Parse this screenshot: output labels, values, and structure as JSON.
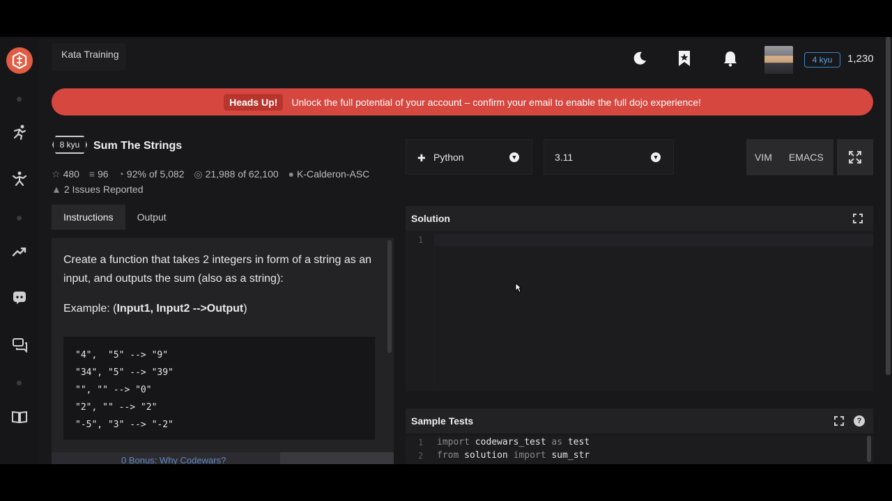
{
  "topbar": {
    "title": "Kata Training",
    "rank": "4 kyu",
    "honor": "1,230"
  },
  "banner": {
    "label": "Heads Up!",
    "message": "Unlock the full potential of your account – confirm your email to enable the full dojo experience!"
  },
  "kata": {
    "rank": "8 kyu",
    "title": "Sum The Strings",
    "stars": "480",
    "collections": "96",
    "satisfaction_pct": "92%",
    "satisfaction_of": "of 5,082",
    "completed": "21,988",
    "completed_of": "of 62,100",
    "author": "K-Calderon-ASC",
    "issues": "2 Issues Reported"
  },
  "tabs": [
    "Instructions",
    "Output"
  ],
  "instructions": {
    "text": "Create a function that takes 2 integers in form of a string as an input, and outputs the sum (also as a string):",
    "example_prefix": "Example: (",
    "example_bold": "Input1, Input2 -->Output",
    "example_suffix": ")",
    "code": "\"4\",  \"5\" --> \"9\"\n\"34\", \"5\" --> \"39\"\n\"\", \"\" --> \"0\"\n\"2\", \"\" --> \"2\"\n\"-5\", \"3\" --> \"-2\"",
    "bottom_link": "0 Bonus: Why Codewars?"
  },
  "editor_settings": {
    "language": "Python",
    "version": "3.11",
    "modes": [
      "VIM",
      "EMACS"
    ]
  },
  "solution": {
    "title": "Solution",
    "line_numbers": [
      "1"
    ]
  },
  "sample_tests": {
    "title": "Sample Tests",
    "lines": [
      {
        "n": "1",
        "kw1": "import",
        "a": " codewars_test ",
        "kw2": "as",
        "b": " test"
      },
      {
        "n": "2",
        "kw1": "from",
        "a": " solution ",
        "kw2": "import",
        "b": " sum_str"
      }
    ]
  },
  "colors": {
    "accent": "#e05d44",
    "banner": "#d6473f",
    "rank_blue": "#3d88d0"
  },
  "icons": [
    "codewars-logo-icon",
    "training-icon",
    "practice-icon",
    "leaderboard-icon",
    "discord-icon",
    "discussion-icon",
    "docs-icon",
    "moon-icon",
    "bookmark-icon",
    "bell-icon",
    "star-icon",
    "collection-icon",
    "satisfaction-icon",
    "completed-icon",
    "user-icon",
    "warning-icon",
    "python-icon",
    "chevron-down-icon",
    "expand-icon",
    "help-icon"
  ]
}
